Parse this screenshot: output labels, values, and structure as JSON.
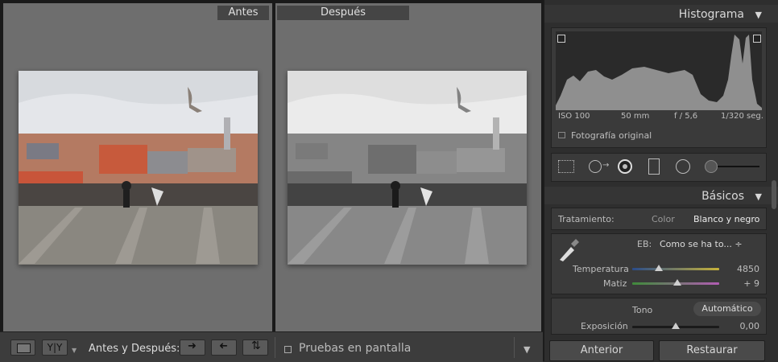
{
  "compare": {
    "before_label": "Antes",
    "after_label": "Después"
  },
  "toolbar": {
    "view_yy": "Y|Y",
    "before_after_label": "Antes y Después:",
    "soft_proof_label": "Pruebas en pantalla"
  },
  "histogram": {
    "title": "Histograma",
    "iso": "ISO 100",
    "focal": "50 mm",
    "aperture": "f / 5,6",
    "shutter": "1/320 seg.",
    "original_photo_label": "Fotografía original"
  },
  "basics": {
    "title": "Básicos",
    "treatment_label": "Tratamiento:",
    "treatment_color": "Color",
    "treatment_bw": "Blanco y negro",
    "wb_label": "EB:",
    "wb_value": "Como se ha to... ÷",
    "temp_label": "Temperatura",
    "temp_value": "4850",
    "tint_label": "Matiz",
    "tint_value": "+ 9",
    "tone_label": "Tono",
    "auto_label": "Automático",
    "exposure_label": "Exposición",
    "exposure_value": "0,00"
  },
  "panel_buttons": {
    "previous": "Anterior",
    "reset": "Restaurar"
  },
  "sliders": {
    "temperature_fraction": 0.31,
    "tint_fraction": 0.52,
    "exposure_fraction": 0.5
  },
  "colors": {
    "accent_white": "#e0e0e0",
    "panel_bg": "#2e2e2e"
  }
}
